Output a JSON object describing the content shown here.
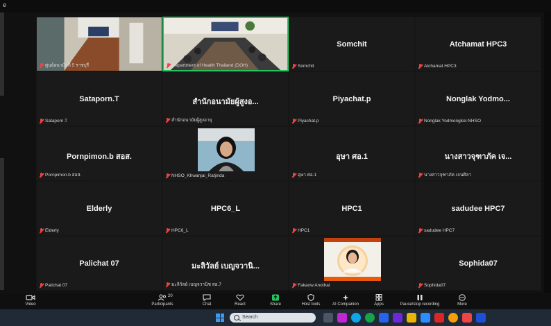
{
  "window": {
    "title": "e"
  },
  "gallery": {
    "tiles": [
      {
        "name": "",
        "label": "ศูนย์อนามัยที่ 5 ราชบุรี",
        "kind": "video-room-a"
      },
      {
        "name": "",
        "label": "Department of Health Thailand (DOH)",
        "kind": "video-room-b",
        "active": true
      },
      {
        "name": "Somchit",
        "label": "Somchit"
      },
      {
        "name": "Atchamat HPC3",
        "label": "Atchamat HPC3"
      },
      {
        "name": "Sataporn.T",
        "label": "Sataporn.T"
      },
      {
        "name": "สำนักอนามัยผู้สูงอ...",
        "label": "สำนักอนามัยผู้สูงอายุ"
      },
      {
        "name": "Piyachat.p",
        "label": "Piyachat.p"
      },
      {
        "name": "Nonglak Yodmo...",
        "label": "Nonglak Yodmongkol-NHSO"
      },
      {
        "name": "Pornpimon.b สอส.",
        "label": "Pornpimon.b สอส."
      },
      {
        "name": "",
        "label": "NHSO_Khwanjai_Ratjinda",
        "kind": "video-woman"
      },
      {
        "name": "อุษา ศอ.1",
        "label": "อุษา ศอ.1"
      },
      {
        "name": "นางสาวจุฑาภัค เจ...",
        "label": "นางสาวจุฑาภัค เจนศิลา"
      },
      {
        "name": "Elderly",
        "label": "Elderly"
      },
      {
        "name": "HPC6_L",
        "label": "HPC6_L"
      },
      {
        "name": "HPC1",
        "label": "HPC1"
      },
      {
        "name": "sadudee HPC7",
        "label": "sadudee HPC7"
      },
      {
        "name": "Palichat 07",
        "label": "Palichat 07"
      },
      {
        "name": "มะลิวัลย์ เบญจวานิ...",
        "label": "มะลิวัลย์ เบญจวานิช สอ.7"
      },
      {
        "name": "",
        "label": "Fakaow Anothai",
        "kind": "avatar-photo"
      },
      {
        "name": "Sophida07",
        "label": "Sophida07"
      }
    ]
  },
  "toolbar": {
    "video": "Video",
    "participants": "Participants",
    "participants_count": "20",
    "chat": "Chat",
    "react": "React",
    "share": "Share",
    "host_tools": "Host tools",
    "ai_companion": "AI Companion",
    "apps": "Apps",
    "pause_stop_recording": "Pause/stop recording",
    "more": "More"
  },
  "taskbar": {
    "search_placeholder": "Search"
  },
  "colors": {
    "active_border": "#22c55e",
    "muted_mic": "#ef4444",
    "share_green": "#22c55e",
    "tile_bg": "#1a1a1a"
  }
}
